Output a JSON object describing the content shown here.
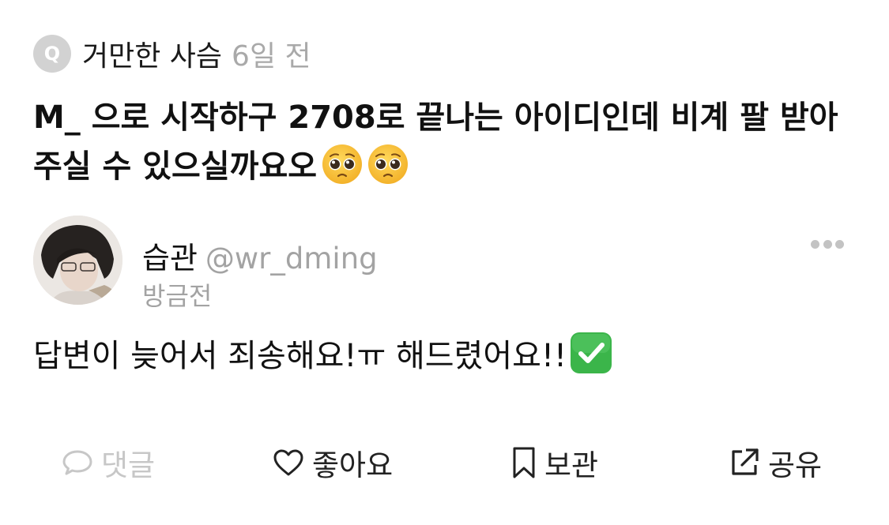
{
  "question": {
    "badge_letter": "Q",
    "author": "거만한 사슴",
    "time": "6일 전",
    "text": "M_ 으로 시작하구 2708로 끝나는 아이디인데 비계 팔 받아 주실 수 있으실까요오",
    "emoji": [
      "pleading-face-emoji",
      "pleading-face-emoji"
    ]
  },
  "answer": {
    "name": "습관",
    "handle": "@wr_dming",
    "time": "방금전",
    "text": "답변이 늦어서 죄송해요!ㅠ 해드렸어요!!",
    "emoji": "check-mark-button-emoji"
  },
  "actions": {
    "comment_label": "댓글",
    "like_label": "좋아요",
    "save_label": "보관",
    "share_label": "공유"
  },
  "colors": {
    "muted": "#a9a9a9",
    "disabled": "#c7c7c7",
    "check_green": "#3bb54a",
    "emoji_yellow": "#f8c53a"
  }
}
